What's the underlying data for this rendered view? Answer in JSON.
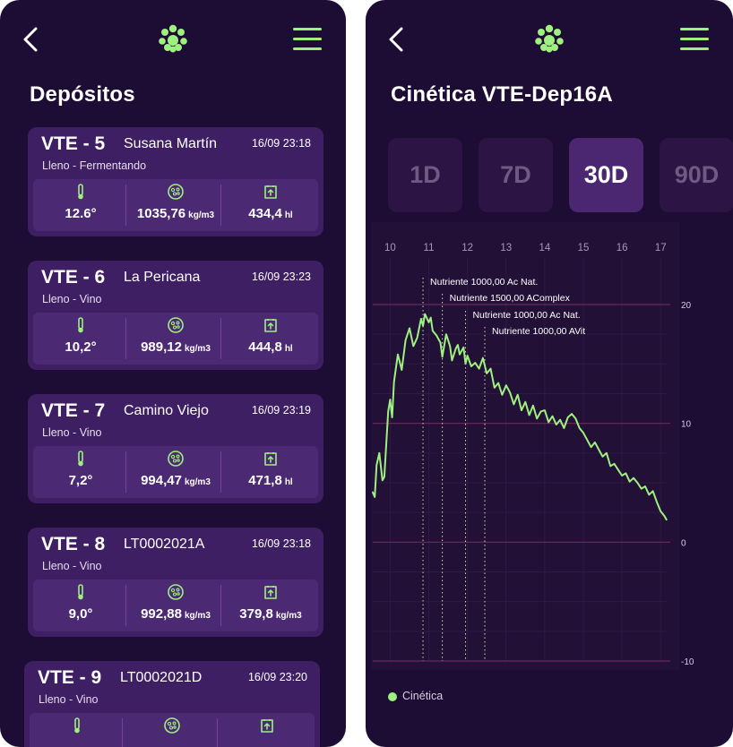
{
  "colors": {
    "background": "#1d0c33",
    "card": "#3f1f63",
    "accent": "#9ef07f",
    "grid_line": "#6a2a5c",
    "text": "#ffffff"
  },
  "left_screen": {
    "header": {
      "back_icon": "chevron-left-icon",
      "logo_icon": "paw-icon",
      "menu_icon": "hamburger-menu-icon"
    },
    "title": "Depósitos",
    "metric_icons": [
      "thermometer-icon",
      "density-icon",
      "volume-icon"
    ],
    "deposits": [
      {
        "id": "VTE - 5",
        "name": "Susana Martín",
        "date": "16/09 23:18",
        "state": "Lleno - Fermentando",
        "temperature": "12.6°",
        "density": "1035,76",
        "density_unit": "kg/m3",
        "volume": "434,4",
        "volume_unit": "hl"
      },
      {
        "id": "VTE - 6",
        "name": "La Pericana",
        "date": "16/09 23:23",
        "state": "Lleno - Vino",
        "temperature": "10,2°",
        "density": "989,12",
        "density_unit": "kg/m3",
        "volume": "444,8",
        "volume_unit": "hl"
      },
      {
        "id": "VTE - 7",
        "name": "Camino Viejo",
        "date": "16/09 23:19",
        "state": "Lleno - Vino",
        "temperature": "7,2°",
        "density": "994,47",
        "density_unit": "kg/m3",
        "volume": "471,8",
        "volume_unit": "hl"
      },
      {
        "id": "VTE - 8",
        "name": "LT0002021A",
        "date": "16/09 23:18",
        "state": "Lleno - Vino",
        "temperature": "9,0°",
        "density": "992,88",
        "density_unit": "kg/m3",
        "volume": "379,8",
        "volume_unit": "kg/m3"
      },
      {
        "id": "VTE - 9",
        "name": "LT0002021D",
        "date": "16/09 23:20",
        "state": "Lleno - Vino",
        "temperature": "",
        "density": "",
        "density_unit": "",
        "volume": "",
        "volume_unit": ""
      }
    ]
  },
  "right_screen": {
    "header": {
      "back_icon": "chevron-left-icon",
      "logo_icon": "paw-icon",
      "menu_icon": "hamburger-menu-icon"
    },
    "title": "Cinética VTE-Dep16A",
    "ranges": [
      {
        "label": "1D",
        "active": false
      },
      {
        "label": "7D",
        "active": false
      },
      {
        "label": "30D",
        "active": true
      },
      {
        "label": "90D",
        "active": false
      }
    ],
    "legend": [
      {
        "label": "Cinética",
        "color": "#9ef07f"
      }
    ]
  },
  "chart_data": {
    "type": "line",
    "x_ticks": [
      10,
      11,
      12,
      13,
      14,
      15,
      16,
      17
    ],
    "xlim": [
      9.55,
      17.25
    ],
    "y_ticks": [
      20,
      10,
      0,
      -10
    ],
    "ylim": [
      -10,
      20
    ],
    "grid": true,
    "legend_position": "bottom-left",
    "annotations": [
      {
        "x": 10.85,
        "label": "Nutriente 1000,00 Ac Nat."
      },
      {
        "x": 11.35,
        "label": "Nutriente 1500,00 AComplex"
      },
      {
        "x": 11.95,
        "label": "Nutriente 1000,00 Ac Nat."
      },
      {
        "x": 12.45,
        "label": "Nutriente 1000,00 AVit"
      }
    ],
    "series": [
      {
        "name": "Cinética",
        "color": "#9ef07f",
        "x": [
          9.55,
          9.6,
          9.65,
          9.72,
          9.8,
          9.85,
          9.95,
          10.0,
          10.05,
          10.1,
          10.2,
          10.3,
          10.4,
          10.5,
          10.6,
          10.7,
          10.8,
          10.85,
          10.9,
          11.0,
          11.05,
          11.1,
          11.2,
          11.3,
          11.35,
          11.45,
          11.55,
          11.6,
          11.7,
          11.75,
          11.8,
          11.9,
          11.95,
          12.0,
          12.1,
          12.2,
          12.3,
          12.4,
          12.5,
          12.6,
          12.7,
          12.8,
          12.9,
          13.0,
          13.1,
          13.2,
          13.3,
          13.4,
          13.5,
          13.6,
          13.7,
          13.8,
          13.9,
          14.0,
          14.1,
          14.2,
          14.3,
          14.4,
          14.5,
          14.6,
          14.7,
          14.8,
          14.9,
          15.0,
          15.1,
          15.2,
          15.3,
          15.4,
          15.5,
          15.6,
          15.7,
          15.8,
          15.9,
          16.0,
          16.1,
          16.2,
          16.3,
          16.4,
          16.5,
          16.6,
          16.7,
          16.8,
          16.9,
          17.0,
          17.1,
          17.15
        ],
        "y": [
          4.2,
          3.8,
          6.5,
          7.5,
          5.2,
          5.5,
          11.0,
          12.0,
          10.5,
          13.5,
          15.8,
          14.5,
          17.0,
          18.0,
          16.5,
          17.2,
          18.8,
          18.2,
          19.2,
          18.5,
          18.9,
          17.8,
          17.4,
          16.8,
          15.6,
          17.5,
          16.5,
          15.3,
          16.3,
          16.6,
          15.8,
          16.4,
          15.0,
          15.7,
          14.8,
          15.1,
          14.6,
          15.5,
          14.2,
          14.6,
          13.0,
          13.4,
          12.4,
          13.2,
          12.6,
          11.6,
          12.4,
          11.1,
          11.8,
          10.7,
          11.5,
          10.4,
          11.0,
          11.1,
          10.1,
          10.6,
          9.9,
          10.3,
          9.6,
          10.5,
          10.8,
          10.4,
          9.6,
          9.2,
          8.6,
          8.0,
          8.4,
          7.8,
          7.2,
          7.5,
          6.4,
          6.6,
          6.1,
          5.6,
          5.8,
          5.1,
          5.4,
          5.0,
          4.5,
          4.7,
          4.0,
          4.3,
          3.4,
          2.6,
          2.2,
          1.9
        ]
      }
    ]
  }
}
